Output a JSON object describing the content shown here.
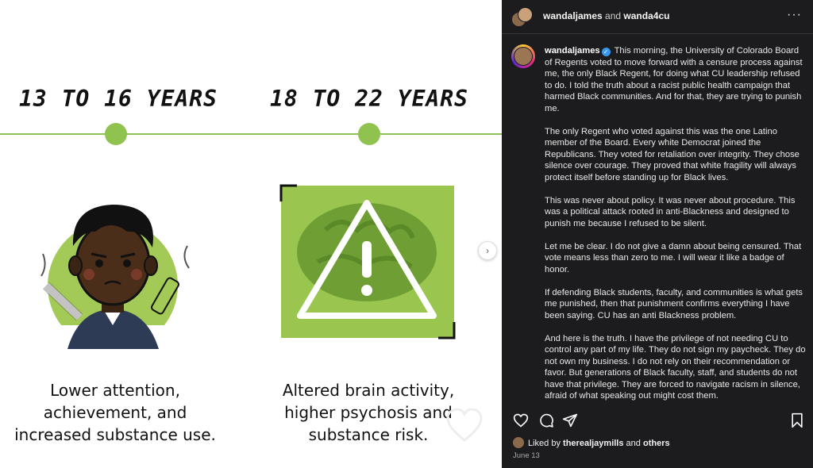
{
  "infographic": {
    "left_title": "13 TO 16 YEARS",
    "right_title": "18 TO 22 YEARS",
    "left_caption": [
      "Lower attention,",
      "achievement, and",
      "increased substance use."
    ],
    "right_caption": [
      "Altered brain activity,",
      "higher psychosis and",
      "substance risk."
    ],
    "accent_color": "#8fc24f"
  },
  "header": {
    "user1": "wandaljames",
    "joiner": "and",
    "user2": "wanda4cu",
    "more_icon": "more-options-icon"
  },
  "caption": {
    "username": "wandaljames",
    "paragraphs": [
      "This morning, the University of Colorado Board of Regents voted to move forward with a censure process against me, the only Black Regent, for doing what CU leadership refused to do. I told the truth about a racist public health campaign that harmed Black communities. And for that, they are trying to punish me.",
      "The only Regent who voted against this was the one Latino member of the Board. Every white Democrat joined the Republicans. They voted for retaliation over integrity. They chose silence over courage. They proved that white fragility will always protect itself before standing up for Black lives.",
      "This was never about policy. It was never about procedure. This was a political attack rooted in anti-Blackness and designed to punish me because I refused to be silent.",
      "Let me be clear. I do not give a damn about being censured. That vote means less than zero to me. I will wear it like a badge of honor.",
      "If defending Black students, faculty, and communities is what gets me punished, then that punishment confirms everything I have been saying. CU has an anti Blackness problem.",
      "And here is the truth. I have the privilege of not needing CU to control any part of my life. They do not sign my paycheck. They do not own my business. I do not rely on their recommendation or favor. But generations of Black faculty, staff, and students do not have that privilege. They are forced to navigate racism in silence, afraid of what speaking out might cost them."
    ]
  },
  "footer": {
    "liked_prefix": "Liked by",
    "liked_user": "therealjaymills",
    "liked_and": "and",
    "liked_others": "others",
    "date": "June 13"
  }
}
